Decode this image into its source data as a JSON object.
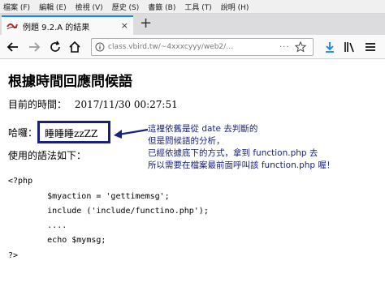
{
  "menu": [
    "檔案 (F)",
    "編輯 (E)",
    "檢視 (V)",
    "歷史 (S)",
    "書籤 (B)",
    "工具 (T)",
    "說明 (H)"
  ],
  "tab": {
    "title": "例題 9.2.A 的結果",
    "close": "×"
  },
  "new_tab": "+",
  "url": {
    "text": "class.vbird.tw/~4xxxcyyy/web2/…",
    "more": "···"
  },
  "page": {
    "title": "根據時間回應問候語",
    "time_label": "目前的時間：",
    "time_value": "2017/11/30 00:27:51",
    "greet_label": "哈囉：",
    "greet_value": "睡睡睡zzZZ",
    "syntax_label": "使用的語法如下："
  },
  "code": [
    "<?php",
    "        $myaction = 'gettimemsg';",
    "        include ('include/functino.php');",
    "        ....",
    "        echo $mymsg;",
    "?>"
  ],
  "annotation": [
    "這裡依舊是從 date 去判斷的",
    "但是問候語的分析，",
    "已經依據底下的方式，拿到 function.php 去",
    "所以需要在檔案最前面呼叫該 function.php 喔！"
  ],
  "colors": {
    "annotation": "#1a237e",
    "box": "#1a1f7a",
    "accent": "#0a84ff"
  }
}
